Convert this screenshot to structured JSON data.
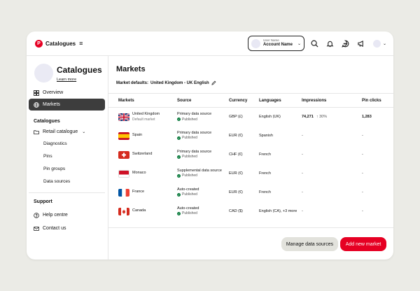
{
  "topbar": {
    "brand": "Catalogues",
    "brand_menu_icon": "≡",
    "account_label": "User Name",
    "account_name": "Account Name"
  },
  "sidebar": {
    "title": "Catalogues",
    "learn_more": "Learn more",
    "nav": [
      {
        "label": "Overview",
        "icon": "grid-icon"
      },
      {
        "label": "Markets",
        "icon": "globe-icon"
      }
    ],
    "catalogues_title": "Catalogues",
    "retail_catalogue": "Retail catalogue",
    "sub_items": [
      "Diagnostics",
      "Pins",
      "Pin groups",
      "Data sources"
    ],
    "support_title": "Support",
    "support_items": [
      {
        "label": "Help centre",
        "icon": "help-icon"
      },
      {
        "label": "Contact us",
        "icon": "mail-icon"
      }
    ]
  },
  "main": {
    "title": "Markets",
    "defaults_label": "Market defaults:",
    "defaults_value": "United Kingdom - UK English",
    "columns": [
      "Markets",
      "Source",
      "Currency",
      "Languages",
      "Impressions",
      "Pin clicks"
    ],
    "rows": [
      {
        "flag": "uk",
        "market": "United Kingdom",
        "sub": "Default market",
        "source": "Primary data source",
        "status": "Published",
        "currency": "GBP (£)",
        "language": "English (UK)",
        "impressions": "74,271",
        "change": "30%",
        "pin_clicks": "1,283"
      },
      {
        "flag": "es",
        "market": "Spain",
        "sub": "",
        "source": "Primary data source",
        "status": "Published",
        "currency": "EUR (€)",
        "language": "Spanish",
        "impressions": "-",
        "change": "",
        "pin_clicks": "-"
      },
      {
        "flag": "ch",
        "market": "Switzerland",
        "sub": "",
        "source": "Primary data source",
        "status": "Published",
        "currency": "CHF (€)",
        "language": "French",
        "impressions": "-",
        "change": "",
        "pin_clicks": "-"
      },
      {
        "flag": "mc",
        "market": "Monaco",
        "sub": "",
        "source": "Supplemental data source",
        "status": "Published",
        "currency": "EUR (€)",
        "language": "French",
        "impressions": "-",
        "change": "",
        "pin_clicks": "-"
      },
      {
        "flag": "fr",
        "market": "France",
        "sub": "",
        "source": "Auto-created",
        "status": "Published",
        "currency": "EUR (€)",
        "language": "French",
        "impressions": "-",
        "change": "",
        "pin_clicks": "-"
      },
      {
        "flag": "ca",
        "market": "Canada",
        "sub": "",
        "source": "Auto-created",
        "status": "Published",
        "currency": "CAD ($)",
        "language": "English (CA), +3 more",
        "impressions": "-",
        "change": "",
        "pin_clicks": "-"
      }
    ]
  },
  "footer": {
    "manage_label": "Manage data sources",
    "add_label": "Add new market"
  },
  "colors": {
    "brand_red": "#e60023",
    "active_nav": "#3d3d3d",
    "published_green": "#0a7a3c"
  }
}
